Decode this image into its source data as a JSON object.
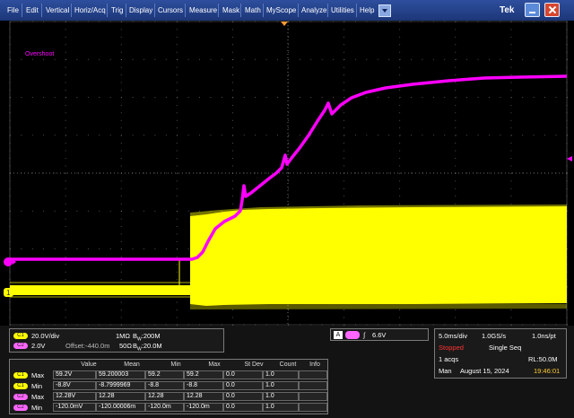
{
  "menu": {
    "items": [
      "File",
      "Edit",
      "Vertical",
      "Horiz/Acq",
      "Trig",
      "Display",
      "Cursors",
      "Measure",
      "Mask",
      "Math",
      "MyScope",
      "Analyze",
      "Utilities",
      "Help"
    ],
    "brand": "Tek"
  },
  "scope": {
    "overshoot_label": "Overshoot",
    "ch1_marker": "1",
    "colors": {
      "ch1": "#ffff00",
      "ch2": "#ff00ff",
      "grid": "#6a6a6a",
      "trigger": "#ff9933"
    }
  },
  "channels": {
    "ch1": {
      "badge": "C1",
      "scale": "20.0V/div",
      "impedance": "1MΩ",
      "bw_prefix": "B",
      "bw_sub": "W",
      "bw": ":200M"
    },
    "ch2": {
      "badge": "C2",
      "scale": "2.0V",
      "offset": "Offset:-440.0m",
      "impedance": "50Ω",
      "bw_prefix": "B",
      "bw_sub": "W",
      "bw": ":20.0M"
    }
  },
  "trigger": {
    "source": "A",
    "slope": "∫",
    "level": "6.6V"
  },
  "acquisition": {
    "timebase": "5.0ms/div",
    "sample_rate": "1.0GS/s",
    "resolution": "1.0ns/pt",
    "status": "Stopped",
    "mode": "Single Seq",
    "acqs": "1 acqs",
    "record_length": "RL:50.0M",
    "day": "Man",
    "date": "August 15, 2024",
    "time": "19:46:01"
  },
  "measurements": {
    "headers": [
      "Value",
      "Mean",
      "Min",
      "Max",
      "St Dev",
      "Count",
      "Info"
    ],
    "rows": [
      {
        "badge": "C1",
        "color": "#ffff00",
        "label": "Max",
        "value": "59.2V",
        "mean": "59.200003",
        "min": "59.2",
        "max": "59.2",
        "stdev": "0.0",
        "count": "1.0",
        "info": ""
      },
      {
        "badge": "C1",
        "color": "#ffff00",
        "label": "Min",
        "value": "-8.8V",
        "mean": "-8.7999969",
        "min": "-8.8",
        "max": "-8.8",
        "stdev": "0.0",
        "count": "1.0",
        "info": ""
      },
      {
        "badge": "C2",
        "color": "#ff66ff",
        "label": "Max",
        "value": "12.28V",
        "mean": "12.28",
        "min": "12.28",
        "max": "12.28",
        "stdev": "0.0",
        "count": "1.0",
        "info": ""
      },
      {
        "badge": "C2",
        "color": "#ff66ff",
        "label": "Min",
        "value": "-120.0mV",
        "mean": "-120.00006m",
        "min": "-120.0m",
        "max": "-120.0m",
        "stdev": "0.0",
        "count": "1.0",
        "info": ""
      }
    ]
  }
}
